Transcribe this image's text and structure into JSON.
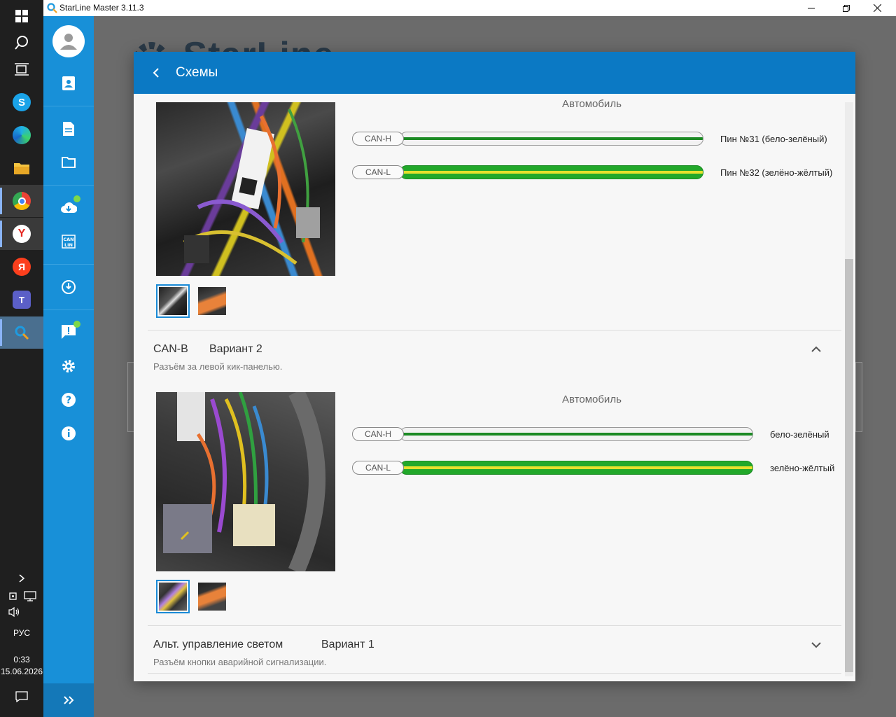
{
  "window": {
    "title": "StarLine Master 3.11.3"
  },
  "taskbar": {
    "language": "РУС",
    "time": "0:33",
    "date": "15.06.2026"
  },
  "background": {
    "logo_text": "StarLine"
  },
  "dialog": {
    "title": "Схемы",
    "sections": [
      {
        "car_label": "Автомобиль",
        "wires": [
          {
            "tag": "CAN-H",
            "pin": "Пин №31 (бело-зелёный)"
          },
          {
            "tag": "CAN-L",
            "pin": "Пин №32 (зелёно-жёлтый)"
          }
        ]
      },
      {
        "name": "CAN-B",
        "variant": "Вариант 2",
        "description": "Разъём за левой кик-панелью.",
        "car_label": "Автомобиль",
        "wires": [
          {
            "tag": "CAN-H",
            "pin": "бело-зелёный"
          },
          {
            "tag": "CAN-L",
            "pin": "зелёно-жёлтый"
          }
        ]
      },
      {
        "name": "Альт. управление светом",
        "variant": "Вариант 1",
        "description": "Разъём кнопки аварийной сигнализации."
      }
    ]
  }
}
